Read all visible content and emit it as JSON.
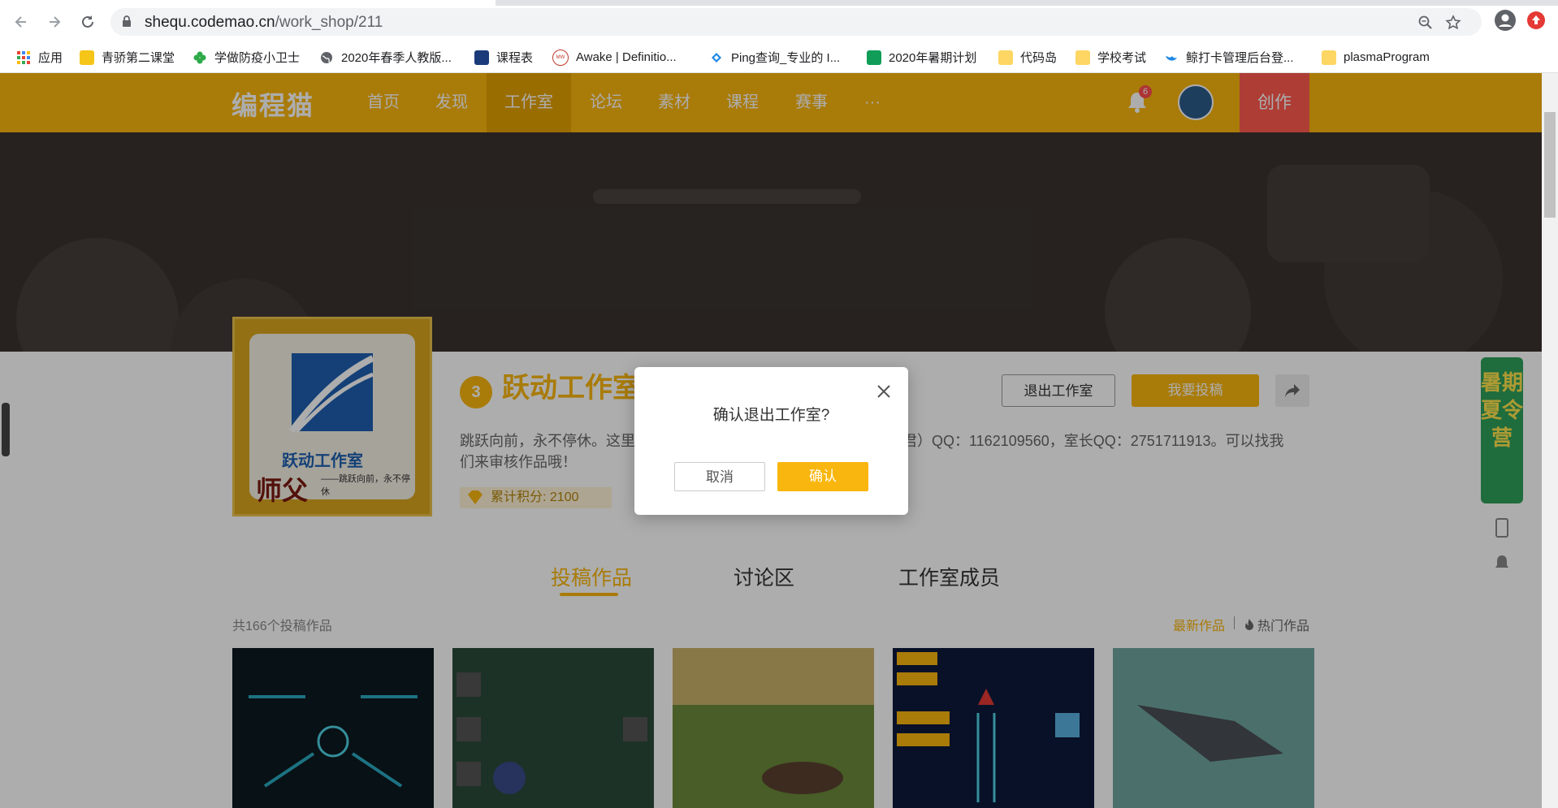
{
  "browser": {
    "url_host": "shequ.codemao.cn",
    "url_path": "/work_shop/211",
    "bookmarks": [
      {
        "label": "应用",
        "icon": "apps-grid-icon"
      },
      {
        "label": "青骄第二课堂",
        "icon": "graduation-icon"
      },
      {
        "label": "学做防疫小卫士",
        "icon": "clover-icon"
      },
      {
        "label": "2020年春季人教版...",
        "icon": "globe-icon"
      },
      {
        "label": "课程表",
        "icon": "schedule-icon"
      },
      {
        "label": "Awake | Definitio...",
        "icon": "mw-icon"
      },
      {
        "label": "Ping查询_专业的 I...",
        "icon": "ping-icon"
      },
      {
        "label": "2020年暑期计划",
        "icon": "sheets-icon"
      },
      {
        "label": "代码岛",
        "icon": "folder-icon"
      },
      {
        "label": "学校考试",
        "icon": "folder-icon"
      },
      {
        "label": "鲸打卡管理后台登...",
        "icon": "whale-icon"
      },
      {
        "label": "plasmaProgram",
        "icon": "folder-icon"
      }
    ]
  },
  "nav": {
    "logo": "编程猫",
    "items": [
      "首页",
      "发现",
      "工作室",
      "论坛",
      "素材",
      "课程",
      "赛事",
      "···"
    ],
    "active": "工作室",
    "notification_count": "6",
    "create": "创作"
  },
  "workshop": {
    "avatar_caption": "跃动工作室",
    "avatar_slogan": "——跳跃向前，永不停休",
    "avatar_mark": "师父",
    "level": "3",
    "name": "跃动工作室",
    "desc_left": "跳跃向前，永不停休。这里",
    "desc_right": "君）QQ：1162109560，室长QQ：2751711913。可以找我",
    "desc_line2": "们来审核作品哦！",
    "points": "累计积分: 2100",
    "exit_button": "退出工作室",
    "submit_button": "我要投稿"
  },
  "tabs": [
    "投稿作品",
    "讨论区",
    "工作室成员"
  ],
  "works": {
    "count": "共166个投稿作品",
    "sort_new": "最新作品",
    "sort_hot": "热门作品"
  },
  "float_ad": {
    "text": "暑期夏令营"
  },
  "modal": {
    "title": "确认退出工作室?",
    "cancel": "取消",
    "confirm": "确认"
  },
  "colors": {
    "brand": "#f9b60e",
    "create": "#ff5a4f"
  }
}
